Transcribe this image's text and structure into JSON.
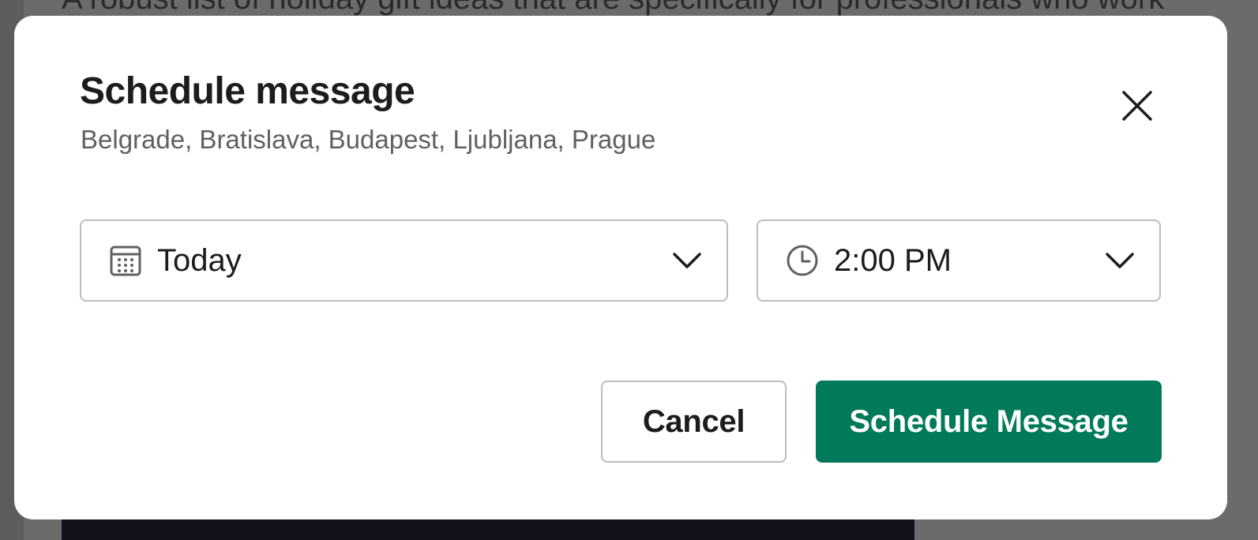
{
  "background": {
    "text": "A robust list of holiday gift ideas that are specifically for professionals who work"
  },
  "modal": {
    "title": "Schedule message",
    "subtitle": "Belgrade, Bratislava, Budapest, Ljubljana, Prague",
    "close_icon": "close-icon"
  },
  "date_select": {
    "icon": "calendar-icon",
    "value": "Today"
  },
  "time_select": {
    "icon": "clock-icon",
    "value": "2:00 PM"
  },
  "actions": {
    "cancel_label": "Cancel",
    "submit_label": "Schedule Message"
  },
  "colors": {
    "primary": "#007a5a",
    "overlay": "#5c5c5c",
    "text": "#1d1c1d",
    "subtle_text": "#616061",
    "border": "#bdbdbd"
  }
}
